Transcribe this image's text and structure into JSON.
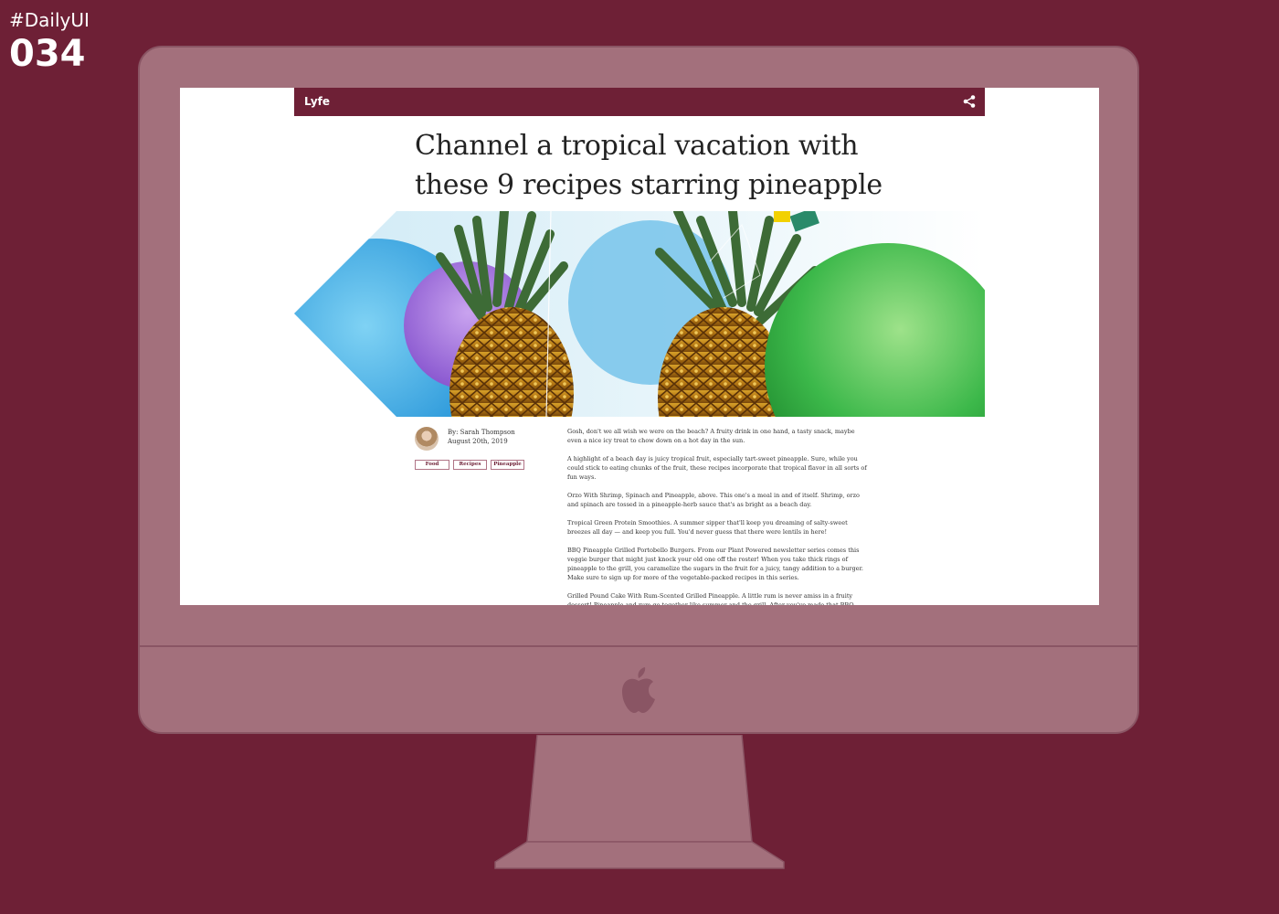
{
  "badge": {
    "tag": "#DailyUI",
    "number": "034"
  },
  "colors": {
    "brand": "#6e2036",
    "monitor": "#a3707c",
    "background": "#6e2036"
  },
  "app": {
    "logo": "Lyfe",
    "share_icon": "share-icon"
  },
  "article": {
    "title": "Channel a tropical vacation with these 9 recipes starring pineapple",
    "author": "By: Sarah Thompson",
    "date": "August 20th, 2019",
    "tags": [
      "Food",
      "Recipes",
      "Pineapple"
    ],
    "paragraphs": [
      "Gosh, don't we all wish we were on the beach? A fruity drink in one hand, a tasty snack, maybe even a nice icy treat to chow down on a hot day in the sun.",
      "A highlight of a beach day is juicy tropical fruit, especially tart-sweet pineapple. Sure, while you could stick to eating chunks of the fruit, these recipes incorporate that tropical flavor in all sorts of fun ways.",
      "Orzo With Shrimp, Spinach and Pineapple, above. This one's a meal in and of itself. Shrimp, orzo and spinach are tossed in a pineapple-herb sauce that's as bright as a beach day.",
      "Tropical Green Protein Smoothies. A summer sipper that'll keep you dreaming of salty-sweet breezes all day — and keep you full. You'd never guess that there were lentils in here!",
      "BBQ Pineapple Grilled Portobello Burgers. From our Plant Powered newsletter series comes this veggie burger that might just knock your old one off the roster! When you take thick rings of pineapple to the grill, you caramelize the sugars in the fruit for a juicy, tangy addition to a burger. Make sure to sign up for more of the vegetable-packed recipes in this series.",
      "Grilled Pound Cake With Rum-Scented Grilled Pineapple. A little rum is never amiss in a fruity dessert! Pineapple and rum go together like summer and the grill. After you've made that BBQ"
    ]
  }
}
